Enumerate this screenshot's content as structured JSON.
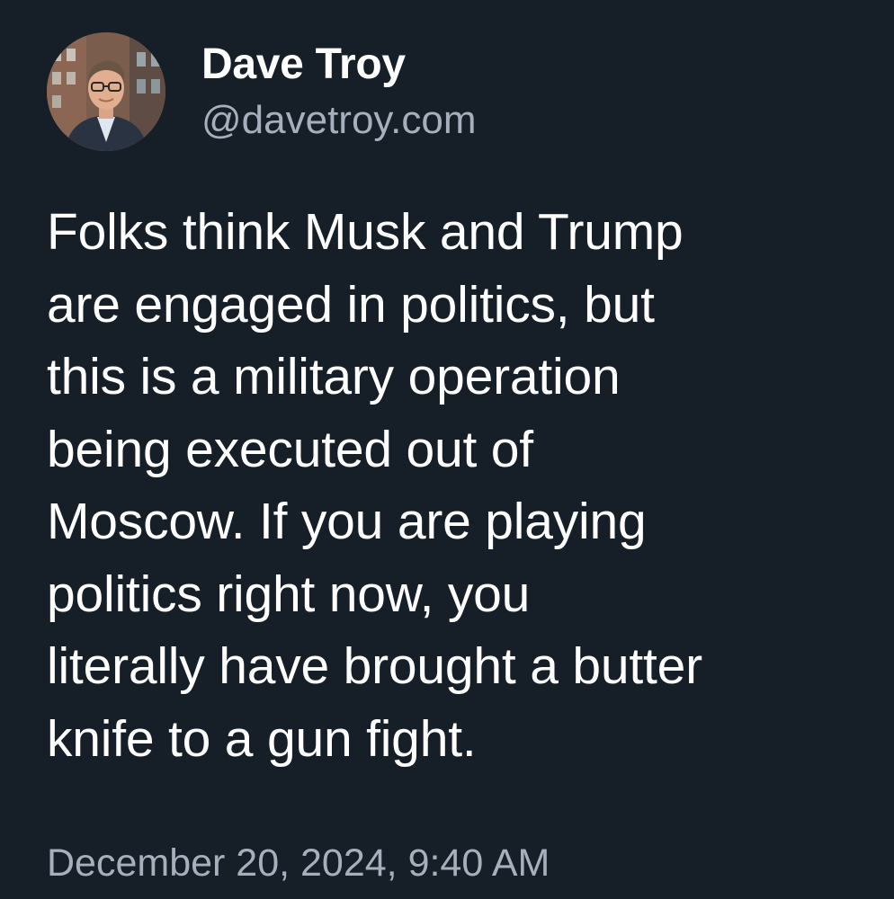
{
  "author": {
    "display_name": "Dave Troy",
    "handle": "@davetroy.com",
    "avatar_icon": "profile-photo"
  },
  "post": {
    "lines": [
      "Folks think Musk and Trump",
      "are engaged in politics, but",
      "this is a military operation",
      "being executed out of",
      "Moscow. If you are playing",
      "politics right now, you",
      "literally have brought a butter",
      "knife to a gun fight."
    ],
    "timestamp": "December 20, 2024, 9:40 AM"
  },
  "colors": {
    "background": "#161e27",
    "primary_text": "#ffffff",
    "secondary_text": "#a6b0bd"
  }
}
